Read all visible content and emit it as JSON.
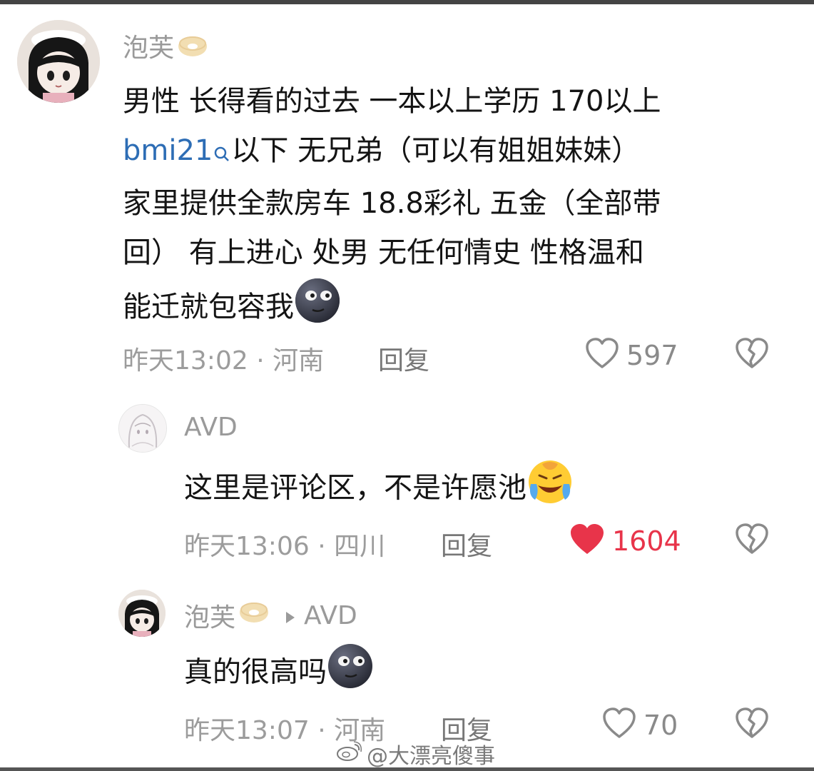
{
  "comments": [
    {
      "username": "泡芙",
      "lines": [
        "男性  长得看的过去  一本以上学历  170以上",
        "以下  无兄弟（可以有姐姐妹妹）",
        "家里提供全款房车  18.8彩礼 五金（全部带",
        "回）  有上进心  处男 无任何情史 性格温和",
        "能迁就包容我"
      ],
      "link_text": "bmi21",
      "meta": "昨天13:02 · 河南",
      "reply_label": "回复",
      "likes": "597",
      "liked": false
    },
    {
      "username": "AVD",
      "lines": [
        "这里是评论区，不是许愿池"
      ],
      "meta": "昨天13:06 · 四川",
      "reply_label": "回复",
      "likes": "1604",
      "liked": true
    },
    {
      "username": "泡芙",
      "reply_to": "AVD",
      "lines": [
        "真的很高吗"
      ],
      "meta": "昨天13:07 · 河南",
      "reply_label": "回复",
      "likes": "70",
      "liked": false
    }
  ],
  "watermark": "@大漂亮傻事",
  "colors": {
    "liked": "#e8344a",
    "link": "#2d6db5",
    "meta": "#9c9c9c"
  },
  "icons": [
    "bagel-emoji",
    "search-icon",
    "new-moon-face-emoji",
    "laughing-crying-emoji",
    "heart-outline-icon",
    "heart-filled-icon",
    "broken-heart-icon",
    "triangle-right-icon",
    "weibo-logo"
  ]
}
